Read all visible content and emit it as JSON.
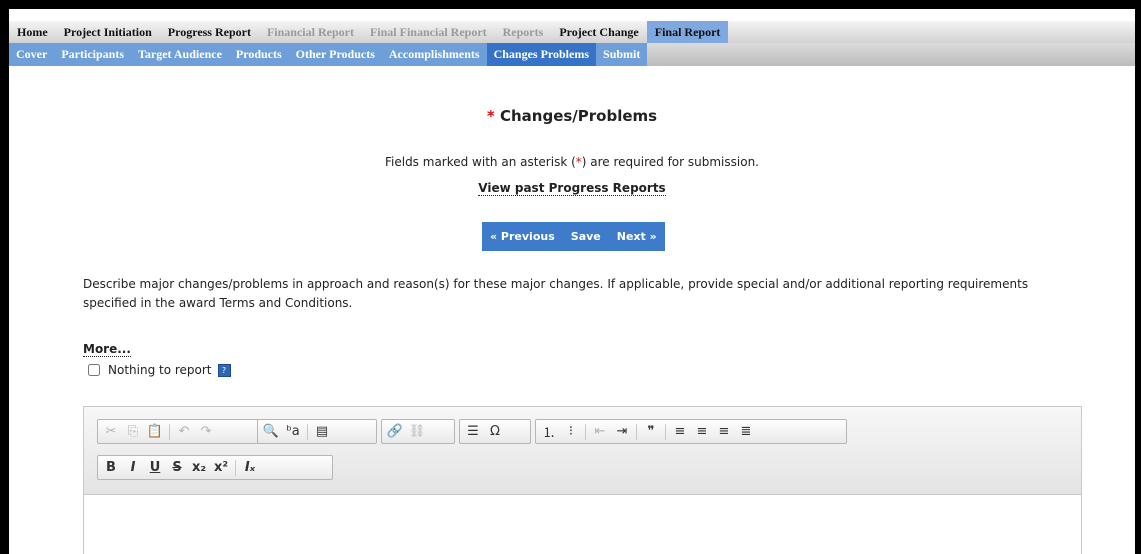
{
  "nav_top": {
    "items": [
      {
        "label": "Home",
        "state": "normal"
      },
      {
        "label": "Project Initiation",
        "state": "normal"
      },
      {
        "label": "Progress Report",
        "state": "normal"
      },
      {
        "label": "Financial Report",
        "state": "disabled"
      },
      {
        "label": "Final Financial Report",
        "state": "disabled"
      },
      {
        "label": "Reports",
        "state": "disabled"
      },
      {
        "label": "Project Change",
        "state": "normal"
      },
      {
        "label": "Final Report",
        "state": "active"
      }
    ]
  },
  "nav_sub": {
    "items": [
      {
        "label": "Cover"
      },
      {
        "label": "Participants"
      },
      {
        "label": "Target Audience"
      },
      {
        "label": "Products"
      },
      {
        "label": "Other Products"
      },
      {
        "label": "Accomplishments"
      },
      {
        "label": "Changes Problems",
        "active": true
      },
      {
        "label": "Submit"
      }
    ]
  },
  "page": {
    "required_mark": "*",
    "title": "Changes/Problems",
    "note_prefix": "Fields marked with an asterisk (",
    "note_asterisk": "*",
    "note_suffix": ") are required for submission.",
    "past_reports_link": "View past Progress Reports",
    "prev_button": "« Previous",
    "save_button": "Save",
    "next_button": "Next »",
    "description": "Describe major changes/problems in approach and reason(s) for these major changes. If applicable, provide special and/or additional reporting requirements specified in the award Terms and Conditions.",
    "more_link": "More...",
    "nothing_checkbox_label": "Nothing to report",
    "nothing_checked": false,
    "help_icon": "?"
  },
  "editor": {
    "content": "",
    "toolbar_row1": [
      {
        "name": "cut-icon",
        "glyph": "✂",
        "disabled": true
      },
      {
        "name": "copy-icon",
        "glyph": "⎘",
        "disabled": true
      },
      {
        "name": "paste-icon",
        "glyph": "📋",
        "disabled": false
      },
      {
        "sep": true
      },
      {
        "name": "undo-icon",
        "glyph": "↶",
        "disabled": true
      },
      {
        "name": "redo-icon",
        "glyph": "↷",
        "disabled": true
      },
      {
        "group_end": true
      },
      {
        "name": "find-icon",
        "glyph": "🔍",
        "disabled": false
      },
      {
        "name": "replace-icon",
        "glyph": "ᵇa",
        "disabled": false
      },
      {
        "sep": true
      },
      {
        "name": "select-all-icon",
        "glyph": "▤",
        "disabled": false
      },
      {
        "group_end": true
      },
      {
        "name": "link-icon",
        "glyph": "🔗",
        "disabled": false
      },
      {
        "name": "unlink-icon",
        "glyph": "⛓",
        "disabled": true
      },
      {
        "group_end": true
      },
      {
        "name": "horizontal-line-icon",
        "glyph": "☰",
        "disabled": false
      },
      {
        "name": "special-char-icon",
        "glyph": "Ω",
        "disabled": false
      },
      {
        "group_end": true
      },
      {
        "name": "numbered-list-icon",
        "glyph": "⒈",
        "disabled": false
      },
      {
        "name": "bulleted-list-icon",
        "glyph": "⁝",
        "disabled": false
      },
      {
        "sep": true
      },
      {
        "name": "outdent-icon",
        "glyph": "⇤",
        "disabled": true
      },
      {
        "name": "indent-icon",
        "glyph": "⇥",
        "disabled": false
      },
      {
        "sep": true
      },
      {
        "name": "blockquote-icon",
        "glyph": "❞",
        "disabled": false
      },
      {
        "sep": true
      },
      {
        "name": "align-left-icon",
        "glyph": "≡",
        "disabled": false
      },
      {
        "name": "align-center-icon",
        "glyph": "≡",
        "disabled": false
      },
      {
        "name": "align-right-icon",
        "glyph": "≡",
        "disabled": false
      },
      {
        "name": "justify-icon",
        "glyph": "≣",
        "disabled": false
      }
    ],
    "toolbar_row2": [
      {
        "name": "bold-icon",
        "glyph": "B",
        "disabled": false
      },
      {
        "name": "italic-icon",
        "glyph": "I",
        "disabled": false
      },
      {
        "name": "underline-icon",
        "glyph": "U",
        "disabled": false
      },
      {
        "name": "strikethrough-icon",
        "glyph": "S",
        "disabled": false
      },
      {
        "name": "subscript-icon",
        "glyph": "x₂",
        "disabled": false
      },
      {
        "name": "superscript-icon",
        "glyph": "x²",
        "disabled": false
      },
      {
        "sep": true
      },
      {
        "name": "remove-format-icon",
        "glyph": "Iₓ",
        "disabled": false
      }
    ]
  }
}
